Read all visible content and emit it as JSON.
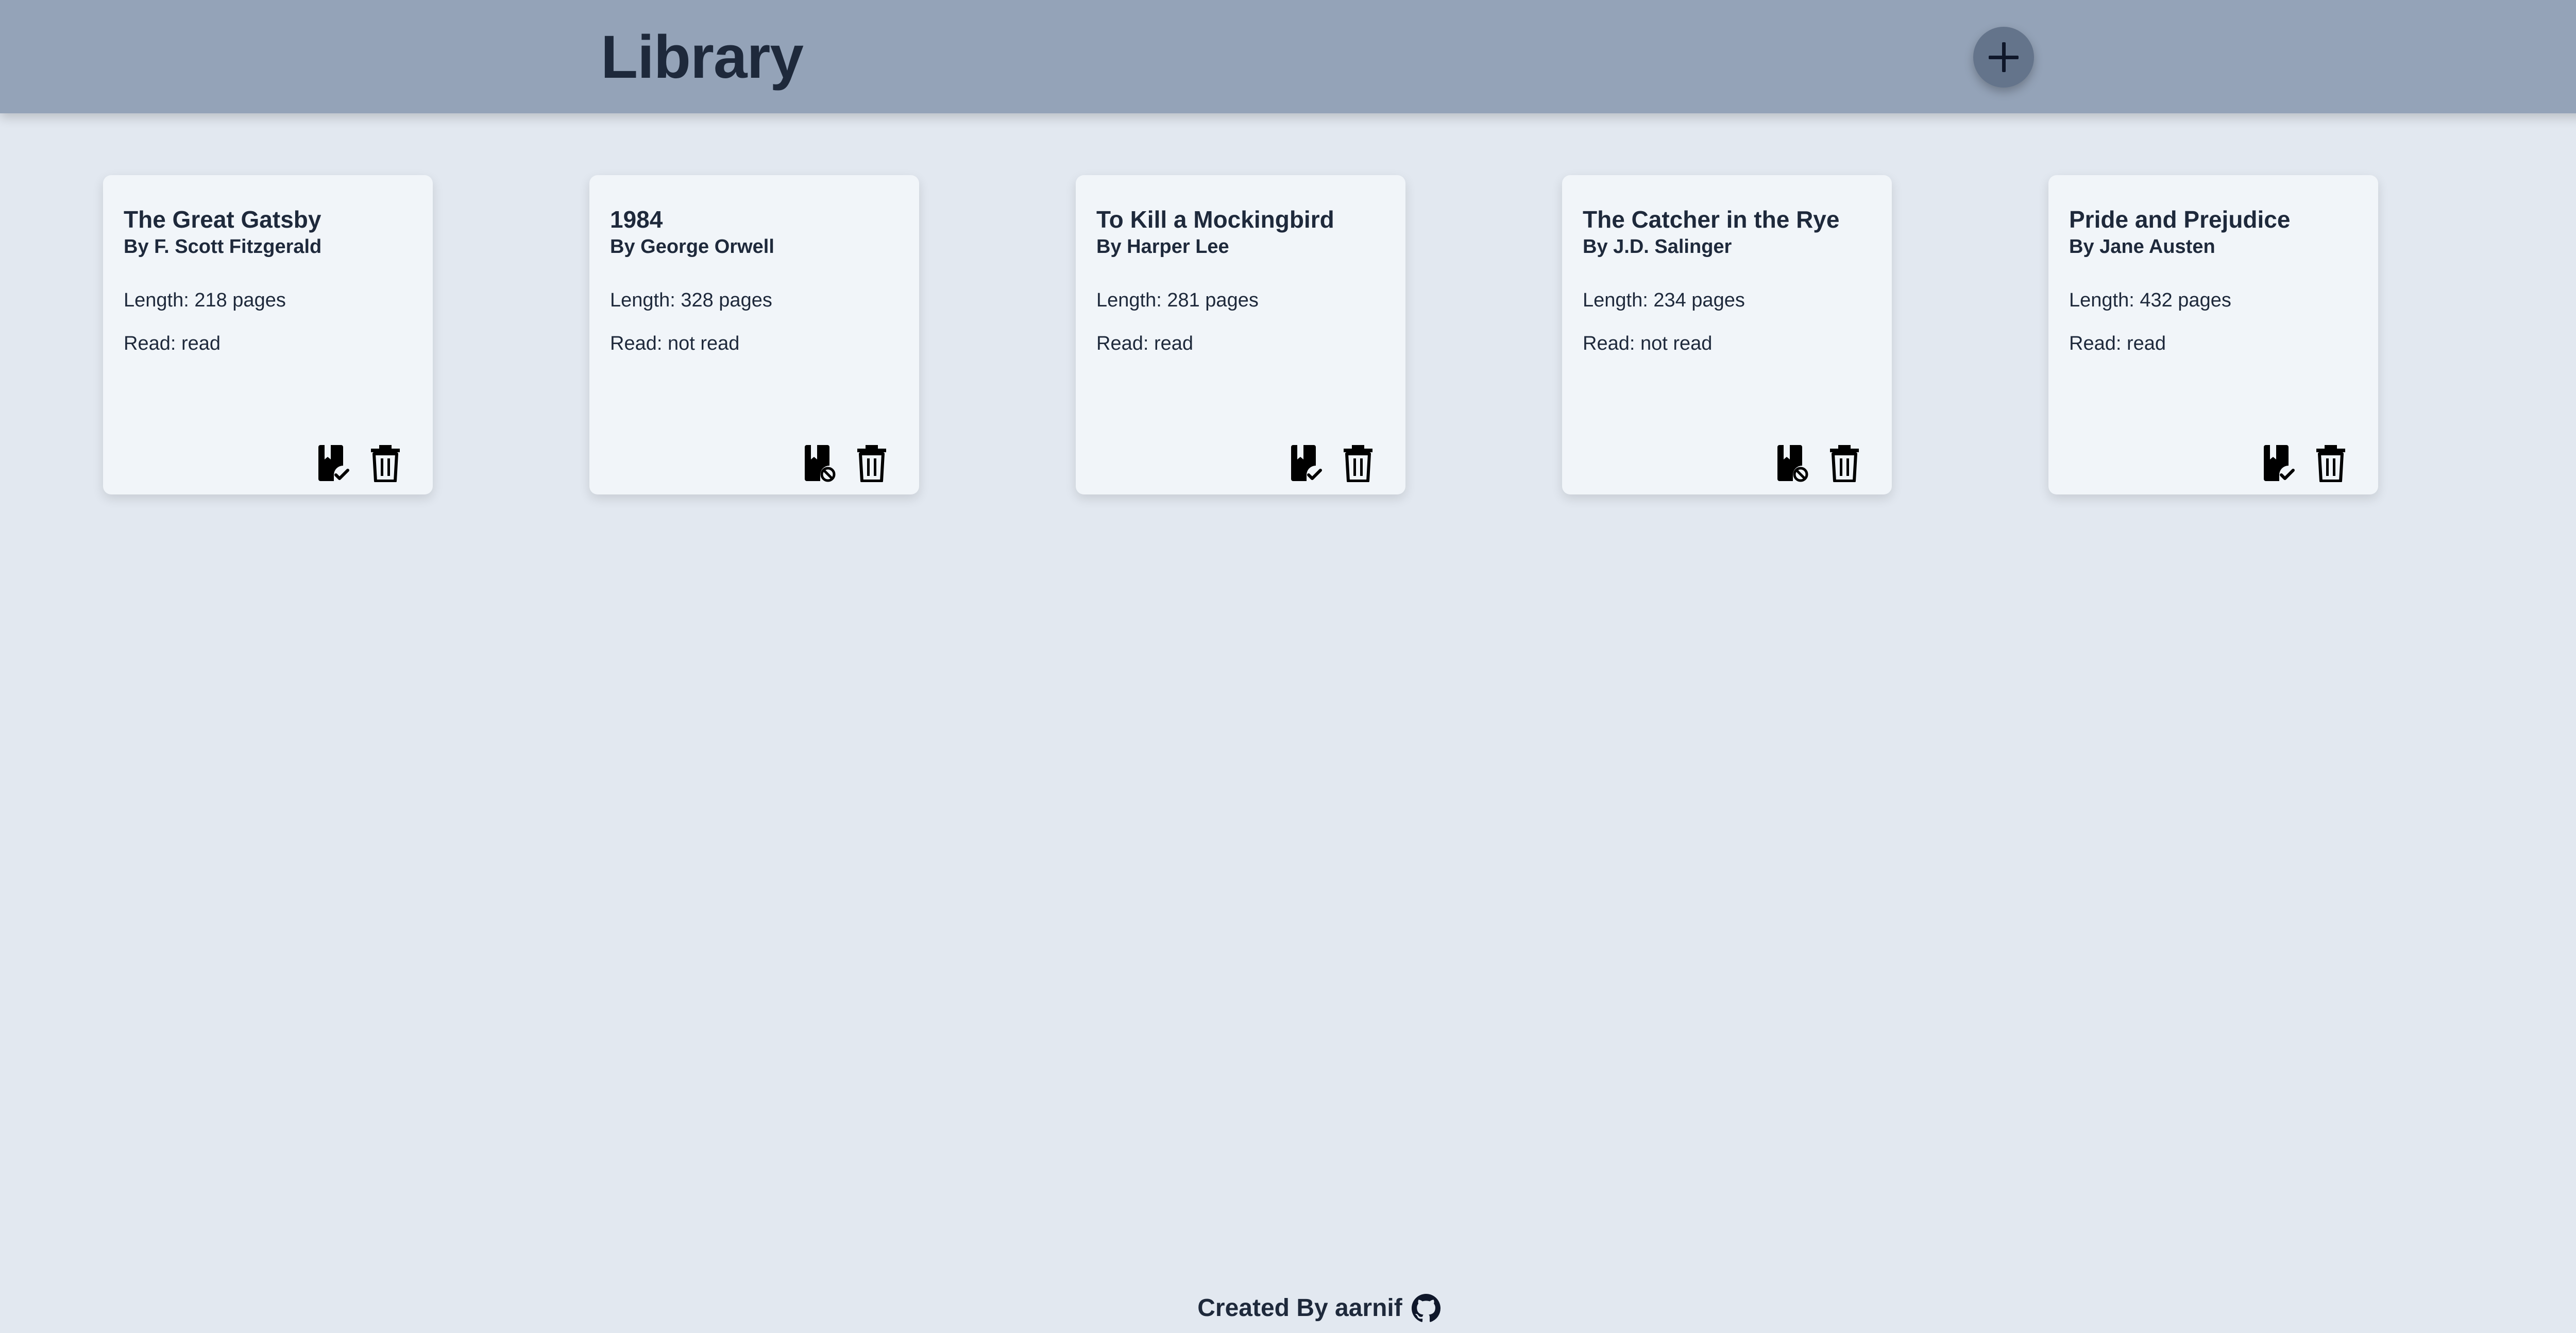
{
  "header": {
    "title": "Library",
    "add_button_icon": "plus-icon"
  },
  "books": [
    {
      "title": "The Great Gatsby",
      "author": "By F. Scott Fitzgerald",
      "length": "Length: 218 pages",
      "read": "Read: read",
      "read_state": "read",
      "toggle_icon": "bookmark-check-icon",
      "delete_icon": "trash-icon"
    },
    {
      "title": "1984",
      "author": "By George Orwell",
      "length": "Length: 328 pages",
      "read": "Read: not read",
      "read_state": "not read",
      "toggle_icon": "bookmark-off-icon",
      "delete_icon": "trash-icon"
    },
    {
      "title": "To Kill a Mockingbird",
      "author": "By Harper Lee",
      "length": "Length: 281 pages",
      "read": "Read: read",
      "read_state": "read",
      "toggle_icon": "bookmark-check-icon",
      "delete_icon": "trash-icon"
    },
    {
      "title": "The Catcher in the Rye",
      "author": "By J.D. Salinger",
      "length": "Length: 234 pages",
      "read": "Read: not read",
      "read_state": "not read",
      "toggle_icon": "bookmark-off-icon",
      "delete_icon": "trash-icon"
    },
    {
      "title": "Pride and Prejudice",
      "author": "By Jane Austen",
      "length": "Length: 432 pages",
      "read": "Read: read",
      "read_state": "read",
      "toggle_icon": "bookmark-check-icon",
      "delete_icon": "trash-icon"
    }
  ],
  "footer": {
    "text": "Created By aarnif",
    "link_icon": "github-icon"
  },
  "colors": {
    "page_background": "#e2e8f0",
    "header_background": "#94a3b8",
    "add_button": "#64748b",
    "card_background": "#f1f5f9",
    "text": "#1e293b"
  }
}
